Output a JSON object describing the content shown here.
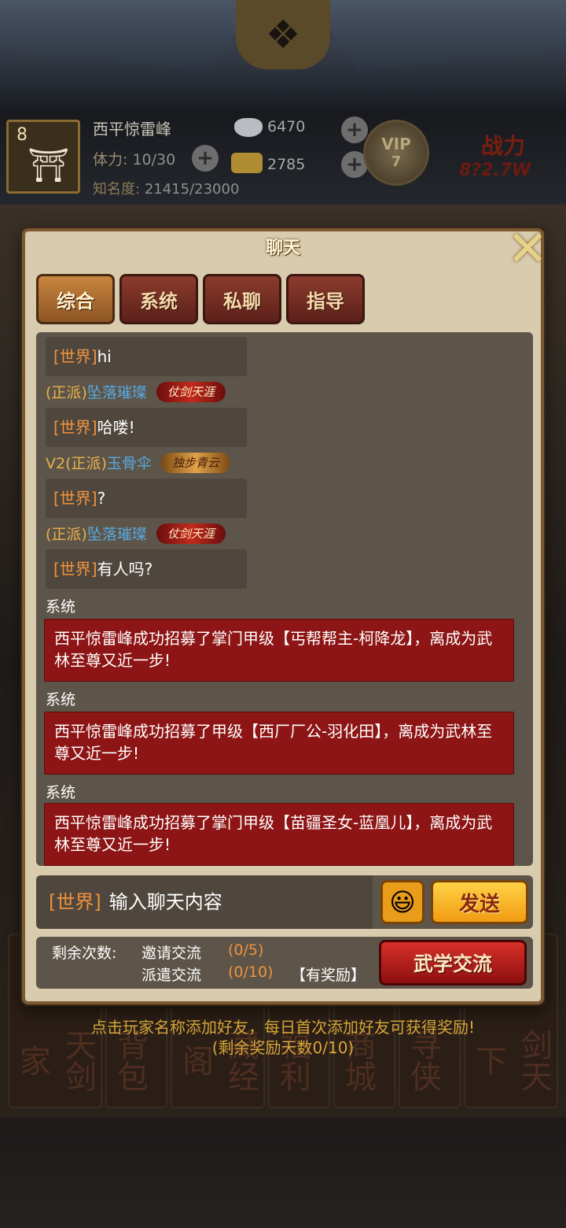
{
  "status": {
    "level": "8",
    "player_name": "西平惊雷峰",
    "stamina_label": "体力:",
    "stamina_value": "10/30",
    "fame_label": "知名度:",
    "fame_value": "21415/23000",
    "silver": "6470",
    "gold": "2785",
    "vip_label": "VIP",
    "vip_level": "7",
    "power_label": "战力",
    "power_value": "8?2.7W"
  },
  "modal": {
    "title": "聊天",
    "tabs": [
      {
        "label": "综合",
        "active": true
      },
      {
        "label": "系统",
        "active": false
      },
      {
        "label": "私聊",
        "active": false
      },
      {
        "label": "指导",
        "active": false
      }
    ]
  },
  "messages": [
    {
      "channel": "[世界]",
      "text": "hi"
    },
    {
      "channel": "[世界]",
      "text": "哈喽!"
    },
    {
      "channel": "[世界]",
      "text": "?"
    },
    {
      "channel": "[世界]",
      "text": "有人吗?"
    }
  ],
  "senders": [
    {
      "prefix": "(正派)",
      "name": "坠落璀璨",
      "badge": "仗剑天涯"
    },
    {
      "prefix": "V2(正派)",
      "name": "玉骨伞",
      "badge": "独步青云"
    },
    {
      "prefix": "(正派)",
      "name": "坠落璀璨",
      "badge": "仗剑天涯"
    }
  ],
  "system_messages": [
    {
      "label": "系统",
      "text": "西平惊雷峰成功招募了掌门甲级【丐帮帮主-柯降龙】，离成为武林至尊又近一步!"
    },
    {
      "label": "系统",
      "text": "西平惊雷峰成功招募了甲级【西厂厂公-羽化田】，离成为武林至尊又近一步!"
    },
    {
      "label": "系统",
      "text": "西平惊雷峰成功招募了掌门甲级【苗疆圣女-蓝凰儿】，离成为武林至尊又近一步!"
    }
  ],
  "input": {
    "channel": "[世界]",
    "placeholder": "输入聊天内容",
    "send_label": "发送"
  },
  "exchange": {
    "remain_label": "剩余次数:",
    "invite_label": "邀请交流",
    "invite_count": "(0/5)",
    "dispatch_label": "派遣交流",
    "dispatch_count": "(0/10)",
    "reward_note": "【有奖励】",
    "button_label": "武学交流"
  },
  "hint": {
    "line1": "点击玩家名称添加好友，每日首次添加好友可获得奖励!",
    "line2": "(剩余奖励天数0/10)"
  },
  "bottom_menu": [
    "天剑家",
    "背包",
    "藏经阁",
    "福利",
    "商城",
    "寻侠",
    "剑天下"
  ],
  "colors": {
    "channel": "#f0923c",
    "sender_name": "#58a9e0",
    "faction": "#e9b14a",
    "system_box": "#8e1515",
    "modal_bg": "#d9ccae"
  }
}
